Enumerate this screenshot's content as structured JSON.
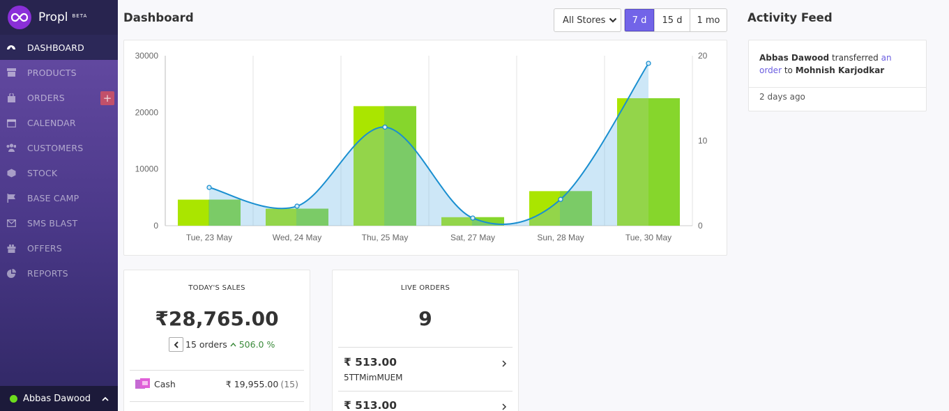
{
  "brand": {
    "name": "Propl",
    "tag": "BETA"
  },
  "sidebar": {
    "items": [
      {
        "label": "DASHBOARD",
        "icon": "dashboard-icon",
        "active": true
      },
      {
        "label": "PRODUCTS",
        "icon": "archive-icon"
      },
      {
        "label": "ORDERS",
        "icon": "shopping-bag-icon"
      },
      {
        "label": "CALENDAR",
        "icon": "calendar-icon"
      },
      {
        "label": "CUSTOMERS",
        "icon": "users-icon"
      },
      {
        "label": "STOCK",
        "icon": "cube-icon"
      },
      {
        "label": "BASE CAMP",
        "icon": "flag-icon"
      },
      {
        "label": "SMS BLAST",
        "icon": "envelope-icon"
      },
      {
        "label": "OFFERS",
        "icon": "gift-icon"
      },
      {
        "label": "REPORTS",
        "icon": "pie-chart-icon"
      }
    ],
    "orders_add": "+",
    "user": {
      "name": "Abbas Dawood",
      "status_color": "#6ddc1e"
    }
  },
  "header": {
    "title": "Dashboard",
    "store_select": "All Stores",
    "ranges": [
      "7 d",
      "15 d",
      "1 mo"
    ],
    "active_range": "7 d"
  },
  "chart_data": {
    "type": "bar",
    "categories": [
      "Tue, 23 May",
      "Wed, 24 May",
      "Thu, 25 May",
      "Sat, 27 May",
      "Sun, 28 May",
      "Tue, 30 May"
    ],
    "series": [
      {
        "type": "bar",
        "axis": "left",
        "values": [
          4600,
          3000,
          21100,
          1500,
          6100,
          22500
        ],
        "color": "#a6e300"
      },
      {
        "type": "area-spline",
        "axis": "right",
        "values": [
          4.5,
          2.3,
          11.6,
          0.9,
          3.1,
          19.1
        ],
        "color": "#1a8fd0"
      }
    ],
    "ylim_left": [
      0,
      30000
    ],
    "ylim_right": [
      0,
      20
    ],
    "yticks_left": [
      "30000",
      "20000",
      "10000",
      "0"
    ],
    "yticks_right": [
      "20",
      "10",
      "0"
    ],
    "grid": "vertical"
  },
  "today_sales": {
    "title": "TODAY'S SALES",
    "amount": "₹28,765.00",
    "orders": "15 orders",
    "growth": "506.0 %",
    "payment": {
      "method": "Cash",
      "amount": "₹ 19,955.00",
      "count": "(15)"
    }
  },
  "live_orders": {
    "title": "LIVE ORDERS",
    "count": "9",
    "items": [
      {
        "price": "₹ 513.00",
        "code": "5TTMimMUEM"
      },
      {
        "price": "₹ 513.00",
        "code": ""
      }
    ]
  },
  "activity": {
    "title": "Activity Feed",
    "items": [
      {
        "actor": "Abbas Dawood",
        "verb": "transferred",
        "link": "an order",
        "prep": "to",
        "target": "Mohnish Karjodkar",
        "time": "2 days ago"
      }
    ]
  }
}
